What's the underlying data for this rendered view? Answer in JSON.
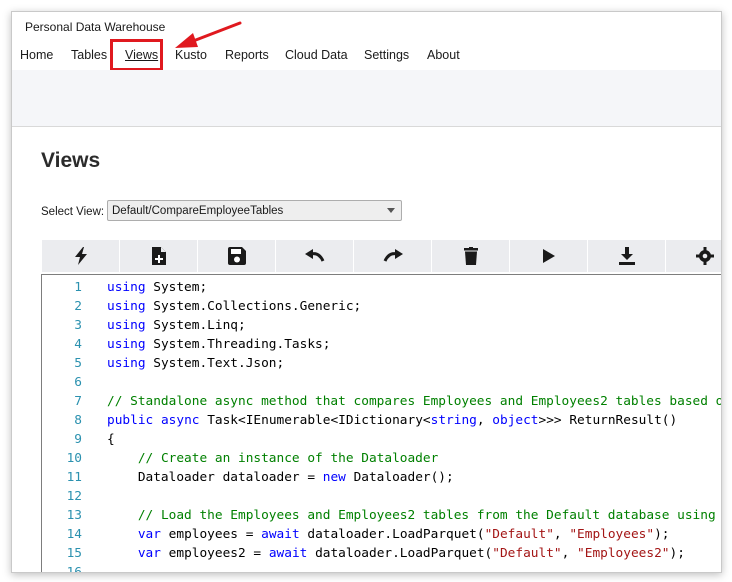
{
  "window": {
    "title": "Personal Data Warehouse"
  },
  "menu": [
    {
      "label": "Home"
    },
    {
      "label": "Tables"
    },
    {
      "label": "Views",
      "active": true
    },
    {
      "label": "Kusto"
    },
    {
      "label": "Reports"
    },
    {
      "label": "Cloud Data"
    },
    {
      "label": "Settings"
    },
    {
      "label": "About"
    }
  ],
  "page": {
    "title": "Views"
  },
  "view_select": {
    "label": "Select View:",
    "value": "Default/CompareEmployeeTables"
  },
  "toolbar": [
    {
      "icon": "bolt-icon",
      "name": "generate-button"
    },
    {
      "icon": "new-file-icon",
      "name": "new-button"
    },
    {
      "icon": "save-icon",
      "name": "save-button"
    },
    {
      "icon": "undo-icon",
      "name": "undo-button"
    },
    {
      "icon": "redo-icon",
      "name": "redo-button"
    },
    {
      "icon": "trash-icon",
      "name": "delete-button"
    },
    {
      "icon": "play-icon",
      "name": "run-button"
    },
    {
      "icon": "download-icon",
      "name": "download-button"
    },
    {
      "icon": "settings-icon",
      "name": "settings-button"
    }
  ],
  "code_lines": [
    {
      "n": "1",
      "tokens": [
        {
          "t": "using",
          "c": "kw"
        },
        {
          "t": " System;"
        }
      ]
    },
    {
      "n": "2",
      "tokens": [
        {
          "t": "using",
          "c": "kw"
        },
        {
          "t": " System.Collections.Generic;"
        }
      ]
    },
    {
      "n": "3",
      "tokens": [
        {
          "t": "using",
          "c": "kw"
        },
        {
          "t": " System.Linq;"
        }
      ]
    },
    {
      "n": "4",
      "tokens": [
        {
          "t": "using",
          "c": "kw"
        },
        {
          "t": " System.Threading.Tasks;"
        }
      ]
    },
    {
      "n": "5",
      "tokens": [
        {
          "t": "using",
          "c": "kw"
        },
        {
          "t": " System.Text.Json;"
        }
      ]
    },
    {
      "n": "6",
      "tokens": []
    },
    {
      "n": "7",
      "tokens": [
        {
          "t": "// Standalone async method that compares Employees and Employees2 tables based o",
          "c": "cm"
        }
      ]
    },
    {
      "n": "8",
      "tokens": [
        {
          "t": "public",
          "c": "kw"
        },
        {
          "t": " "
        },
        {
          "t": "async",
          "c": "kw"
        },
        {
          "t": " Task<IEnumerable<IDictionary<"
        },
        {
          "t": "string",
          "c": "kw"
        },
        {
          "t": ", "
        },
        {
          "t": "object",
          "c": "kw"
        },
        {
          "t": ">>> ReturnResult()"
        }
      ]
    },
    {
      "n": "9",
      "tokens": [
        {
          "t": "{"
        }
      ]
    },
    {
      "n": "10",
      "tokens": [
        {
          "t": "    "
        },
        {
          "t": "// Create an instance of the Dataloader",
          "c": "cm"
        }
      ]
    },
    {
      "n": "11",
      "tokens": [
        {
          "t": "    Dataloader dataloader = "
        },
        {
          "t": "new",
          "c": "kw"
        },
        {
          "t": " Dataloader();"
        }
      ]
    },
    {
      "n": "12",
      "tokens": []
    },
    {
      "n": "13",
      "tokens": [
        {
          "t": "    "
        },
        {
          "t": "// Load the Employees and Employees2 tables from the Default database using",
          "c": "cm"
        }
      ]
    },
    {
      "n": "14",
      "tokens": [
        {
          "t": "    "
        },
        {
          "t": "var",
          "c": "kw"
        },
        {
          "t": " employees = "
        },
        {
          "t": "await",
          "c": "kw"
        },
        {
          "t": " dataloader.LoadParquet("
        },
        {
          "t": "\"Default\"",
          "c": "str"
        },
        {
          "t": ", "
        },
        {
          "t": "\"Employees\"",
          "c": "str"
        },
        {
          "t": ");"
        }
      ]
    },
    {
      "n": "15",
      "tokens": [
        {
          "t": "    "
        },
        {
          "t": "var",
          "c": "kw"
        },
        {
          "t": " employees2 = "
        },
        {
          "t": "await",
          "c": "kw"
        },
        {
          "t": " dataloader.LoadParquet("
        },
        {
          "t": "\"Default\"",
          "c": "str"
        },
        {
          "t": ", "
        },
        {
          "t": "\"Employees2\"",
          "c": "str"
        },
        {
          "t": ");"
        }
      ]
    },
    {
      "n": "16",
      "tokens": []
    }
  ]
}
